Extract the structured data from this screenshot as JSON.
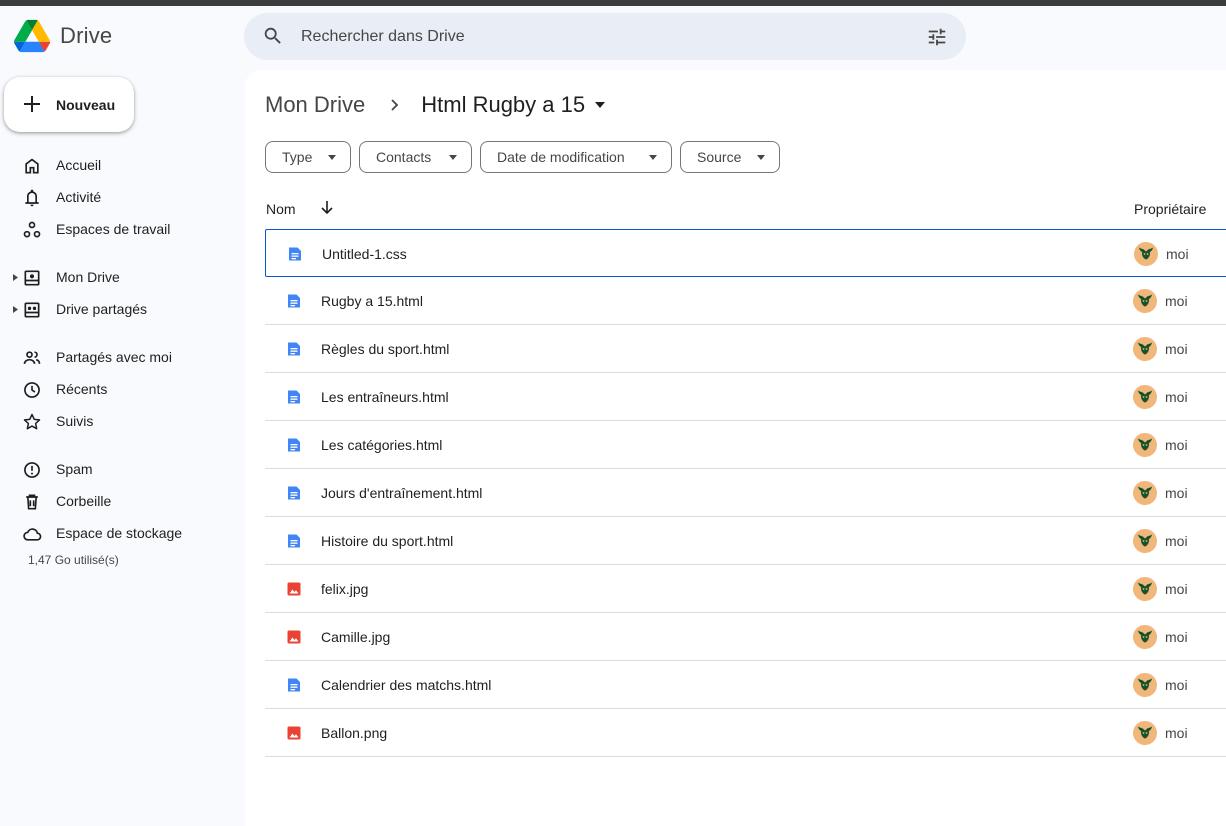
{
  "app": {
    "name": "Drive"
  },
  "search": {
    "placeholder": "Rechercher dans Drive"
  },
  "new_button": {
    "label": "Nouveau"
  },
  "sidebar": {
    "items": [
      {
        "label": "Accueil",
        "icon": "home-icon"
      },
      {
        "label": "Activité",
        "icon": "bell-icon"
      },
      {
        "label": "Espaces de travail",
        "icon": "workspaces-icon"
      },
      {
        "label": "Mon Drive",
        "icon": "my-drive-icon"
      },
      {
        "label": "Drive partagés",
        "icon": "shared-drives-icon"
      },
      {
        "label": "Partagés avec moi",
        "icon": "people-icon"
      },
      {
        "label": "Récents",
        "icon": "clock-icon"
      },
      {
        "label": "Suivis",
        "icon": "star-icon"
      },
      {
        "label": "Spam",
        "icon": "spam-icon"
      },
      {
        "label": "Corbeille",
        "icon": "trash-icon"
      },
      {
        "label": "Espace de stockage",
        "icon": "cloud-icon"
      }
    ],
    "storage_text": "1,47 Go utilisé(s)"
  },
  "breadcrumb": {
    "root": "Mon Drive",
    "current": "Html Rugby a 15"
  },
  "filters": [
    "Type",
    "Contacts",
    "Date de modification",
    "Source"
  ],
  "table": {
    "columns": {
      "name": "Nom",
      "owner": "Propriétaire"
    },
    "rows": [
      {
        "name": "Untitled-1.css",
        "owner": "moi",
        "kind": "doc"
      },
      {
        "name": "Rugby a 15.html",
        "owner": "moi",
        "kind": "doc"
      },
      {
        "name": "Règles du sport.html",
        "owner": "moi",
        "kind": "doc"
      },
      {
        "name": "Les entraîneurs.html",
        "owner": "moi",
        "kind": "doc"
      },
      {
        "name": "Les catégories.html",
        "owner": "moi",
        "kind": "doc"
      },
      {
        "name": "Jours d'entraînement.html",
        "owner": "moi",
        "kind": "doc"
      },
      {
        "name": "Histoire du sport.html",
        "owner": "moi",
        "kind": "doc"
      },
      {
        "name": "felix.jpg",
        "owner": "moi",
        "kind": "image"
      },
      {
        "name": "Camille.jpg",
        "owner": "moi",
        "kind": "image"
      },
      {
        "name": "Calendrier des matchs.html",
        "owner": "moi",
        "kind": "doc"
      },
      {
        "name": "Ballon.png",
        "owner": "moi",
        "kind": "image"
      }
    ]
  },
  "colors": {
    "doc_icon": "#4285f4",
    "image_icon": "#ea4335",
    "selection": "#0b57d0",
    "search_bg": "#e9eef6"
  }
}
